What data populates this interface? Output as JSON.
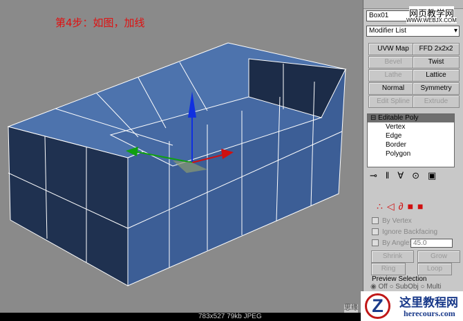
{
  "viewport": {
    "step_text": "第4步：如图，加线"
  },
  "panel": {
    "object_name": "Box01",
    "watermark_top": "网页教学网",
    "watermark_url": "WWW.WEBJX.COM",
    "modifier_list": "Modifier List",
    "buttons": [
      {
        "label": "UVW Map",
        "enabled": true
      },
      {
        "label": "FFD 2x2x2",
        "enabled": true
      },
      {
        "label": "Bevel",
        "enabled": false
      },
      {
        "label": "Twist",
        "enabled": true
      },
      {
        "label": "Lathe",
        "enabled": false
      },
      {
        "label": "Lattice",
        "enabled": true
      },
      {
        "label": "Normal",
        "enabled": true
      },
      {
        "label": "Symmetry",
        "enabled": true
      },
      {
        "label": "Edit Spline",
        "enabled": false
      },
      {
        "label": "Extrude",
        "enabled": false
      }
    ],
    "stack": {
      "header": "Editable Poly",
      "items": [
        "Vertex",
        "Edge",
        "Border",
        "Polygon"
      ]
    },
    "selection": {
      "by_vertex": "By Vertex",
      "ignore_backfacing": "Ignore Backfacing",
      "by_angle": "By Angle:",
      "angle_value": "45.0",
      "shrink": "Shrink",
      "grow": "Grow",
      "ring": "Ring",
      "loop": "Loop",
      "preview": "Preview Selection",
      "off": "Off",
      "subobj": "SubObj",
      "multi": "Multi"
    }
  },
  "status": {
    "info": "783x527  79kb  JPEG",
    "partial": "思缘"
  },
  "logo": {
    "title": "这里教程网",
    "url": "herecours.com"
  }
}
